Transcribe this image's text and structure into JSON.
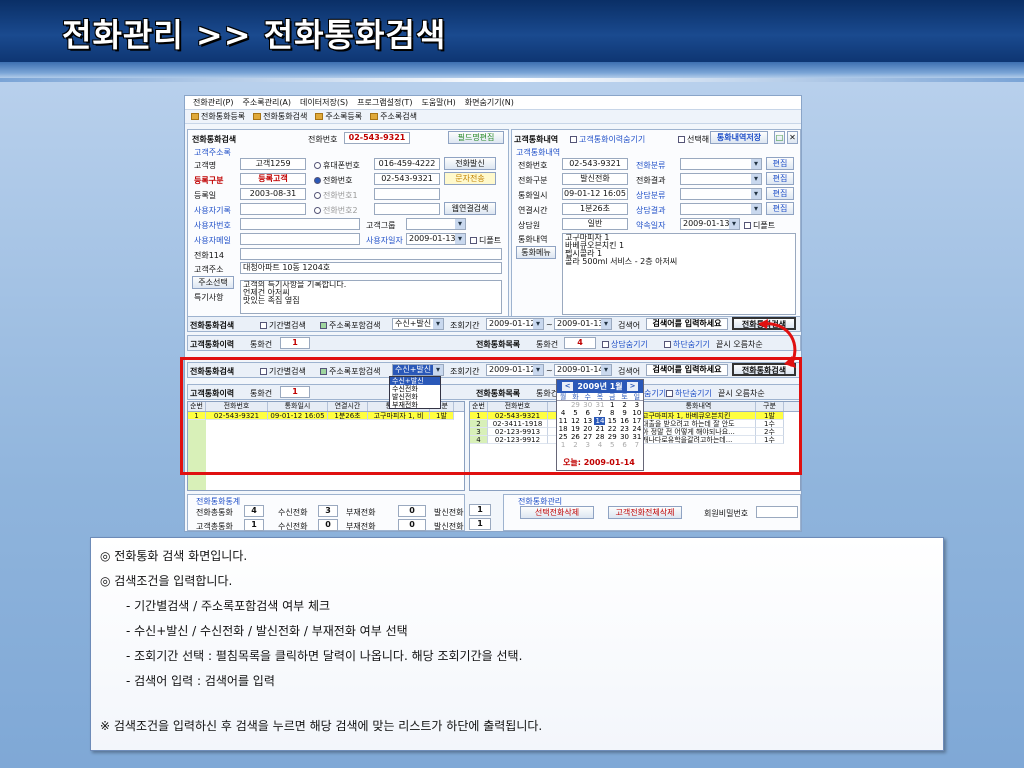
{
  "slide_title": "전화관리 >> 전화통화검색",
  "menu": [
    "전화관리(P)",
    "주소록관리(A)",
    "데이터저장(S)",
    "프로그램설정(T)",
    "도움말(H)",
    "화면숨기기(N)"
  ],
  "toolbar": [
    "전화통화등록",
    "전화통화검색",
    "주소록등록",
    "주소록검색"
  ],
  "left_panel": {
    "title": "전화통화검색",
    "phone_label": "전화번호",
    "phone": "02-543-9321",
    "field_edit_button": "필드명편집",
    "section": "고객주소록",
    "name_label": "고객명",
    "name": "고객1259",
    "mobile_radio": "휴대폰번호",
    "mobile": "016-459-4222",
    "call_button": "전화발신",
    "reg_type_label": "등록구분",
    "reg_type": "등록고객",
    "phone_radio": "전화번호",
    "phone2": "02-543-9321",
    "sms_button": "문자전송",
    "reg_date_label": "등록일",
    "reg_date": "2003-08-31",
    "phone_radio1": "전화번호1",
    "phone_radio2": "전화번호2",
    "user_memo_label": "사용자기록",
    "web_button": "웹연결검색",
    "user_num_label": "사용자번호",
    "group_label": "고객그룹",
    "user_mail_label": "사용자메일",
    "user_date_label": "사용자일자",
    "user_date": "2009-01-13",
    "default_label": "디폴트",
    "phone114_label": "전화114",
    "address_label": "고객주소",
    "address": "대청아파트 10동 1204호",
    "address_button": "주소선택",
    "notes_label": "특기사항",
    "notes_lines": [
      "고객의 특기사항을 기록합니다.",
      "언제건 아저씨",
      "맛있는 족집 옆집"
    ]
  },
  "right_panel": {
    "title": "고객통화내역",
    "hide_label": "고객통화이력숨기기",
    "select_label": "선택해",
    "save_button": "통화내역저장",
    "section": "고객통화내역",
    "phone_label": "전화번호",
    "phone": "02-543-9321",
    "category_label": "전화분류",
    "edit_label": "편집",
    "call_type_label": "전화구분",
    "call_type": "발신전화",
    "result_label": "전화결과",
    "datetime_label": "통화일시",
    "datetime": "09-01-12 16:05",
    "consult_type_label": "상담분류",
    "duration_label": "연결시간",
    "duration": "1분26초",
    "consult_result_label": "상담결과",
    "agent_label": "상담원",
    "agent": "일반",
    "appt_label": "약속일자",
    "appt": "2009-01-13",
    "default_label": "디폴트",
    "history_label": "통화내역",
    "menu_button": "통화메뉴",
    "history_lines": [
      "고구마피자 1",
      "바베큐오븐치킨 1",
      "펩시콜라 1",
      "콜라 500ml 서비스 - 2층 아저씨"
    ]
  },
  "search_bar1": {
    "title": "전화통화검색",
    "period_label": "기간별검색",
    "address_label": "주소록포함검색",
    "call_type": "수신+발신",
    "range_label": "조회기간",
    "from": "2009-01-12",
    "tilde": "~",
    "to": "2009-01-13",
    "word_label": "검색어",
    "word_placeholder": "검색어를 입력하세요",
    "search_button": "전화통화검색"
  },
  "history_bar1": {
    "title": "고객통화이력",
    "count_label": "통화건",
    "count": "1",
    "list_title": "전화통화목록",
    "list_count_label": "통화건",
    "list_count": "4",
    "hide_consult": "상담숨기기",
    "hide_done": "하단숨기기",
    "sort_label": "끝시 오름차순"
  },
  "search_bar2": {
    "title": "전화통화검색",
    "period_label": "기간별검색",
    "address_label": "주소록포함검색",
    "call_type": "수신+발신",
    "range_label": "조회기간",
    "from": "2009-01-12",
    "tilde": "~",
    "to": "2009-01-14",
    "word_label": "검색어",
    "word_placeholder": "검색어를 입력하세요",
    "search_button": "전화통화검색"
  },
  "popup_options": [
    "수신+발신",
    "수신전화",
    "발신전화",
    "부재전화"
  ],
  "history_bar2": {
    "title": "고객통화이력",
    "count_label": "통화건",
    "count": "1",
    "list_title": "전화통화목록",
    "list_count_label": "통화건",
    "hide_consult": "숨기기",
    "hide_done": "하단숨기기",
    "sort_label": "끝시 오름차순"
  },
  "left_grid": {
    "headers": [
      "순번",
      "전화번호",
      "통화일시",
      "연결시간",
      "통화내역",
      "구분"
    ],
    "rows": [
      [
        "1",
        "02-543-9321",
        "09-01-12 16:05",
        "1분26초",
        "고구마피자 1, 비",
        "1발"
      ]
    ]
  },
  "right_grid": {
    "headers": [
      "순번",
      "전화번호",
      "통화내역",
      "구분"
    ],
    "rows": [
      [
        "1",
        "02-543-9321",
        "고구마피자 1, 바베큐오븐치킨",
        "1발"
      ],
      [
        "2",
        "02-3411-1918",
        "대출을 받으려고 하는데 잘 안도",
        "1수"
      ],
      [
        "3",
        "02-123-9913",
        "아 정말 전 어떻게 해야되나요...",
        "2수"
      ],
      [
        "4",
        "02-123-9912",
        "캐나다로유학을갈려고하는데...",
        "1수"
      ]
    ]
  },
  "calendar": {
    "month": "2009년 1월",
    "prev": "<",
    "next": ">",
    "weekdays": [
      "월",
      "화",
      "수",
      "목",
      "금",
      "토",
      "일"
    ],
    "weeks": [
      [
        "29",
        "30",
        "31",
        "1",
        "2",
        "3"
      ],
      [
        "4",
        "5",
        "6",
        "7",
        "8",
        "9",
        "10"
      ],
      [
        "11",
        "12",
        "13",
        "14",
        "15",
        "16",
        "17"
      ],
      [
        "18",
        "19",
        "20",
        "21",
        "22",
        "23",
        "24"
      ],
      [
        "25",
        "26",
        "27",
        "28",
        "29",
        "30",
        "31"
      ],
      [
        "1",
        "2",
        "3",
        "4",
        "5",
        "6",
        "7"
      ]
    ],
    "today": "오늘: 2009-01-14"
  },
  "stats": {
    "section": "전화통화통계",
    "total_label": "전화총통화",
    "total": "4",
    "recv_label": "수신전화",
    "recv": "3",
    "miss_label": "부재전화",
    "miss": "0",
    "send_label": "발신전화",
    "send": "1",
    "cust_label": "고객총통화",
    "cust": "1",
    "recv2": "0",
    "miss2": "0",
    "send2": "1"
  },
  "manage": {
    "section": "전화통화관리",
    "delete_button": "선택전화삭제",
    "delete_all_button": "고객전화전체삭제",
    "password_label": "회원비밀번호"
  },
  "notes": [
    "◎ 전화통화 검색 화면입니다.",
    "◎ 검색조건을 입력합니다.",
    "- 기간별검색 / 주소록포함검색 여부 체크",
    "- 수신+발신 / 수신전화 / 발신전화 / 부재전화 여부 선택",
    "- 조회기간 선택 : 펼침목록을 클릭하면 달력이 나옵니다. 해당 조회기간을 선택.",
    "- 검색어 입력 : 검색어를 입력",
    "※ 검색조건을 입력하신 후 검색을 누르면 해당 검색에 맞는 리스트가 하단에 출력됩니다."
  ]
}
